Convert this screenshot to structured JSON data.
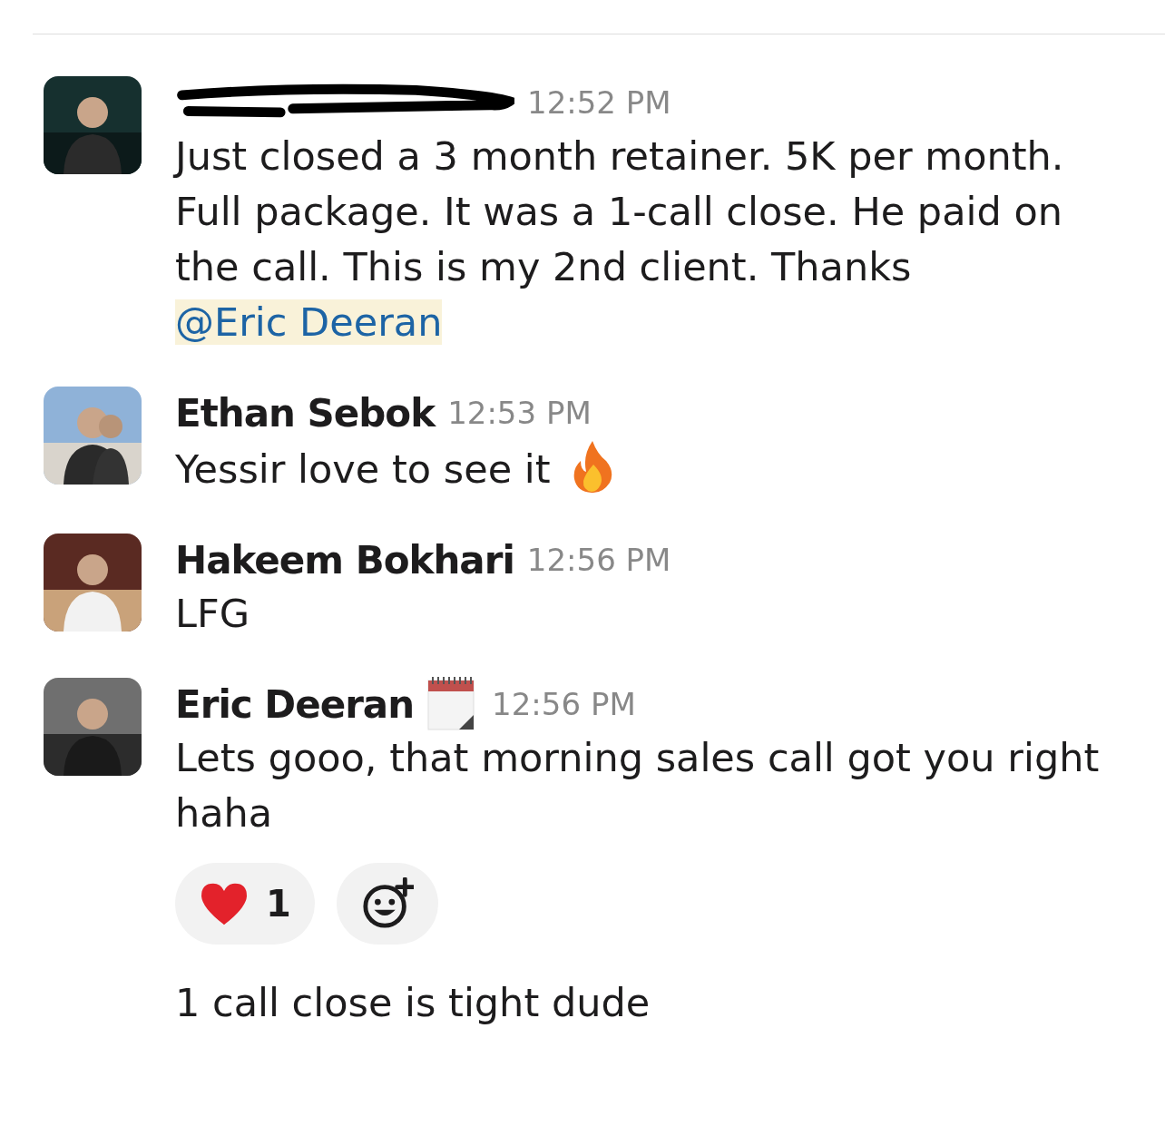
{
  "messages": [
    {
      "kind": "full",
      "redacted": true,
      "avatar": {
        "kind": "picture"
      },
      "time": "12:52 PM",
      "parts": [
        {
          "kind": "text",
          "text": "Just closed a 3 month retainer. 5K per month. Full package. It was a 1-call close. He paid on the call. This is my 2nd client. Thanks "
        },
        {
          "kind": "mention",
          "text": "@Eric "
        },
        {
          "kind": "mention",
          "text": "Deeran"
        }
      ]
    },
    {
      "kind": "full",
      "author": "Ethan Sebok",
      "avatar": {
        "kind": "picture"
      },
      "time": "12:53 PM",
      "parts": [
        {
          "kind": "text",
          "text": "Yessir love to see it "
        },
        {
          "kind": "fire"
        }
      ]
    },
    {
      "kind": "full",
      "author": "Hakeem Bokhari",
      "avatar": {
        "kind": "picture"
      },
      "time": "12:56 PM",
      "parts": [
        {
          "kind": "text",
          "text": "LFG"
        }
      ]
    },
    {
      "kind": "full",
      "author": "Eric Deeran",
      "avatar": {
        "kind": "picture"
      },
      "status": {
        "kind": "calendar"
      },
      "time": "12:56 PM",
      "parts": [
        {
          "kind": "text",
          "text": "Lets gooo, that morning sales call got you right haha"
        }
      ],
      "reactions": [
        {
          "kind": "heart",
          "count": "1"
        }
      ]
    },
    {
      "kind": "continuation",
      "parts": [
        {
          "kind": "text",
          "text": "1 call close is tight dude"
        }
      ]
    }
  ]
}
